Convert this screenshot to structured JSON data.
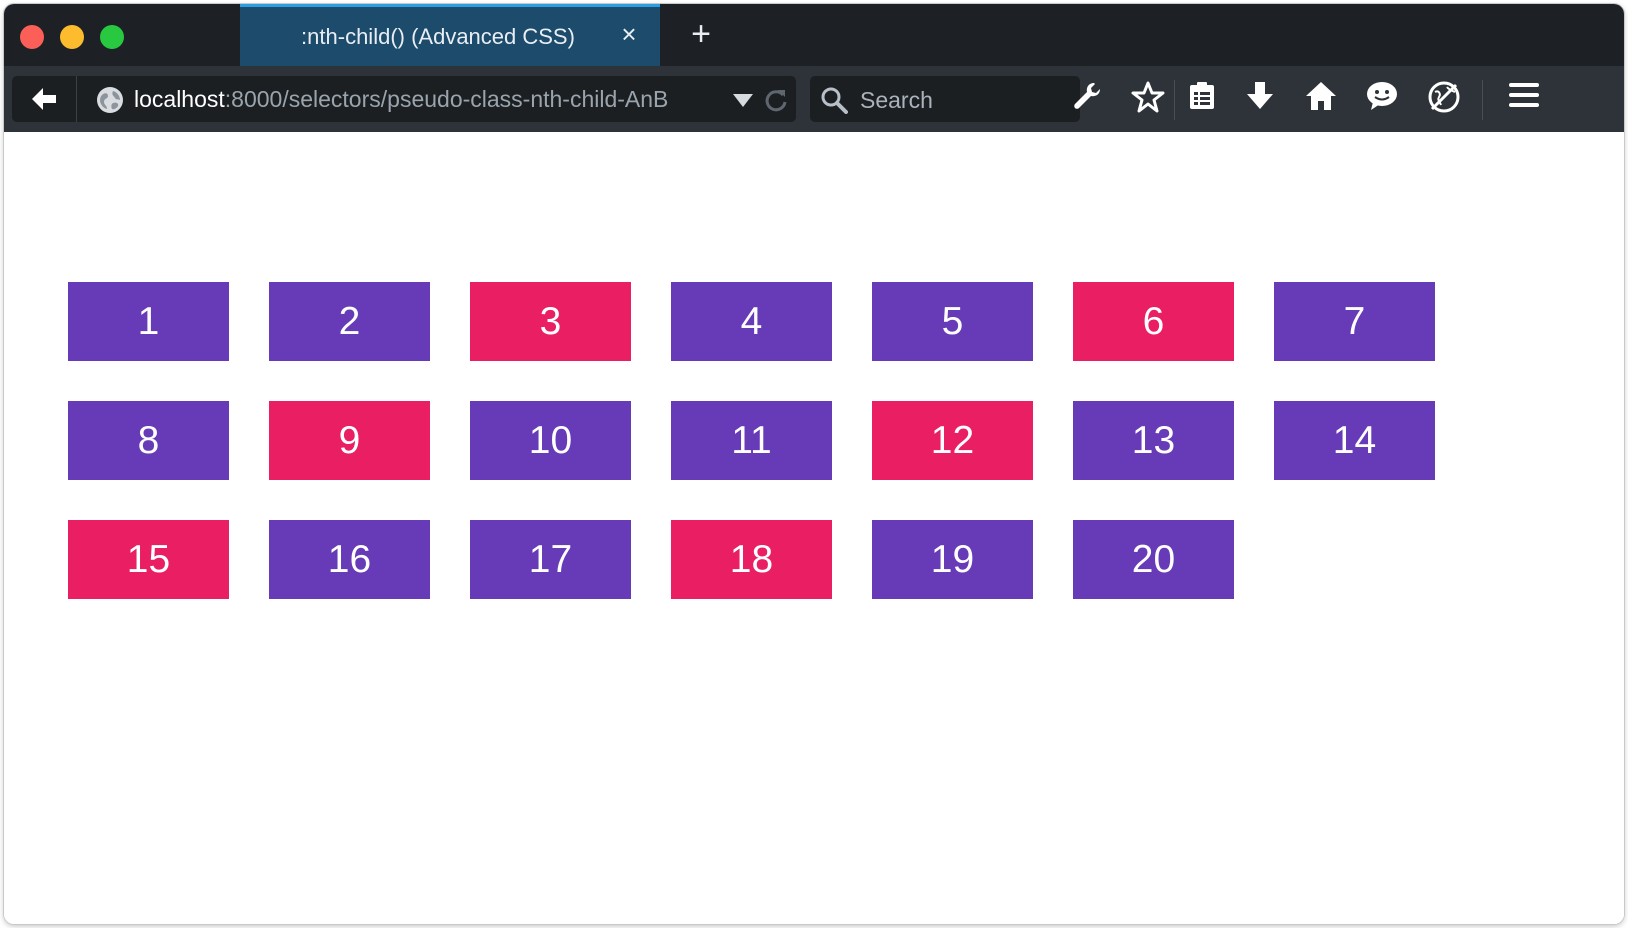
{
  "browser": {
    "tab_title": ":nth-child() (Advanced CSS)",
    "tab_close": "×",
    "new_tab": "+",
    "url_host": "localhost",
    "url_path": ":8000/selectors/pseudo-class-nth-child-AnB",
    "search_placeholder": "Search"
  },
  "colors": {
    "default": "#673ab7",
    "highlight": "#e91e63"
  },
  "boxes": [
    {
      "label": "1",
      "highlight": false
    },
    {
      "label": "2",
      "highlight": false
    },
    {
      "label": "3",
      "highlight": true
    },
    {
      "label": "4",
      "highlight": false
    },
    {
      "label": "5",
      "highlight": false
    },
    {
      "label": "6",
      "highlight": true
    },
    {
      "label": "7",
      "highlight": false
    },
    {
      "label": "8",
      "highlight": false
    },
    {
      "label": "9",
      "highlight": true
    },
    {
      "label": "10",
      "highlight": false
    },
    {
      "label": "11",
      "highlight": false
    },
    {
      "label": "12",
      "highlight": true
    },
    {
      "label": "13",
      "highlight": false
    },
    {
      "label": "14",
      "highlight": false
    },
    {
      "label": "15",
      "highlight": true
    },
    {
      "label": "16",
      "highlight": false
    },
    {
      "label": "17",
      "highlight": false
    },
    {
      "label": "18",
      "highlight": true
    },
    {
      "label": "19",
      "highlight": false
    },
    {
      "label": "20",
      "highlight": false
    }
  ]
}
